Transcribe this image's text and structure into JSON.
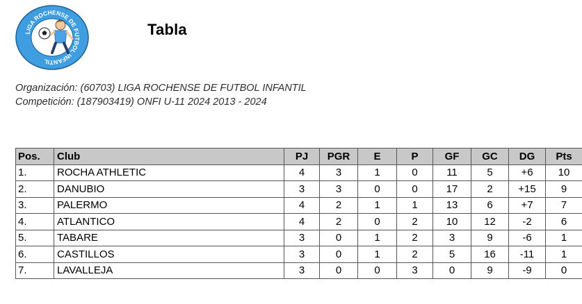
{
  "header": {
    "title": "Tabla",
    "logo_text": "LIGA ROCHENSE DE FUTBOL INFANTIL",
    "organization": "Organización: (60703) LIGA ROCHENSE DE FUTBOL INFANTIL",
    "competition": "Competición: (187903419) ONFI U-11 2024 2013 - 2024"
  },
  "colors": {
    "logo_ring": "#3e9ee0",
    "logo_text": "#ffffff",
    "logo_inner": "#ffffff",
    "header_bg": "#c8c8c8",
    "border": "#555555"
  },
  "table": {
    "columns": [
      "Pos.",
      "Club",
      "PJ",
      "PGR",
      "E",
      "P",
      "GF",
      "GC",
      "DG",
      "Pts"
    ],
    "rows": [
      {
        "pos": "1.",
        "club": "ROCHA ATHLETIC",
        "pj": "4",
        "pgr": "3",
        "e": "1",
        "p": "0",
        "gf": "11",
        "gc": "5",
        "dg": "+6",
        "pts": "10"
      },
      {
        "pos": "2.",
        "club": "DANUBIO",
        "pj": "3",
        "pgr": "3",
        "e": "0",
        "p": "0",
        "gf": "17",
        "gc": "2",
        "dg": "+15",
        "pts": "9"
      },
      {
        "pos": "3.",
        "club": "PALERMO",
        "pj": "4",
        "pgr": "2",
        "e": "1",
        "p": "1",
        "gf": "13",
        "gc": "6",
        "dg": "+7",
        "pts": "7"
      },
      {
        "pos": "4.",
        "club": "ATLANTICO",
        "pj": "4",
        "pgr": "2",
        "e": "0",
        "p": "2",
        "gf": "10",
        "gc": "12",
        "dg": "-2",
        "pts": "6"
      },
      {
        "pos": "5.",
        "club": "TABARE",
        "pj": "3",
        "pgr": "0",
        "e": "1",
        "p": "2",
        "gf": "3",
        "gc": "9",
        "dg": "-6",
        "pts": "1"
      },
      {
        "pos": "6.",
        "club": "CASTILLOS",
        "pj": "3",
        "pgr": "0",
        "e": "1",
        "p": "2",
        "gf": "5",
        "gc": "16",
        "dg": "-11",
        "pts": "1"
      },
      {
        "pos": "7.",
        "club": "LAVALLEJA",
        "pj": "3",
        "pgr": "0",
        "e": "0",
        "p": "3",
        "gf": "0",
        "gc": "9",
        "dg": "-9",
        "pts": "0"
      }
    ]
  }
}
